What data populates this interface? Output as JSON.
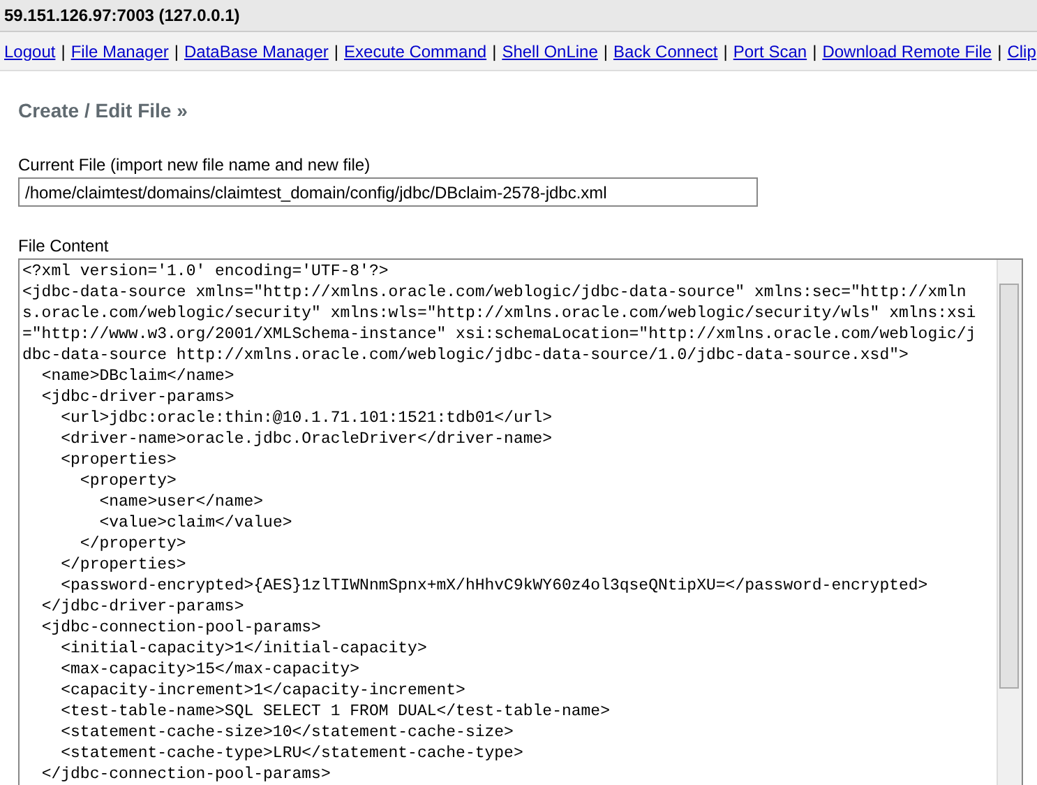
{
  "window": {
    "title": "59.151.126.97:7003 (127.0.0.1)"
  },
  "nav": {
    "separator": "|",
    "links": [
      "Logout",
      "File Manager",
      "DataBase Manager",
      "Execute Command",
      "Shell OnLine",
      "Back Connect",
      "Port Scan",
      "Download Remote File",
      "Clip"
    ]
  },
  "heading": "Create / Edit File »",
  "current_file": {
    "label": "Current File (import new file name and new file)",
    "value": "/home/claimtest/domains/claimtest_domain/config/jdbc/DBclaim-2578-jdbc.xml"
  },
  "file_content": {
    "label": "File Content",
    "lines": [
      "<?xml version='1.0' encoding='UTF-8'?>",
      "<jdbc-data-source xmlns=\"http://xmlns.oracle.com/weblogic/jdbc-data-source\" xmlns:sec=\"http://xmlns.oracle.com/weblogic/security\" xmlns:wls=\"http://xmlns.oracle.com/weblogic/security/wls\" xmlns:xsi=\"http://www.w3.org/2001/XMLSchema-instance\" xsi:schemaLocation=\"http://xmlns.oracle.com/weblogic/jdbc-data-source http://xmlns.oracle.com/weblogic/jdbc-data-source/1.0/jdbc-data-source.xsd\">",
      "  <name>DBclaim</name>",
      "  <jdbc-driver-params>",
      "    <url>jdbc:oracle:thin:@10.1.71.101:1521:tdb01</url>",
      "    <driver-name>oracle.jdbc.OracleDriver</driver-name>",
      "    <properties>",
      "      <property>",
      "        <name>user</name>",
      "        <value>claim</value>",
      "      </property>",
      "    </properties>",
      "    <password-encrypted>{AES}1zlTIWNnmSpnx+mX/hHhvC9kWY60z4ol3qseQNtipXU=</password-encrypted>",
      "  </jdbc-driver-params>",
      "  <jdbc-connection-pool-params>",
      "    <initial-capacity>1</initial-capacity>",
      "    <max-capacity>15</max-capacity>",
      "    <capacity-increment>1</capacity-increment>",
      "    <test-table-name>SQL SELECT 1 FROM DUAL</test-table-name>",
      "    <statement-cache-size>10</statement-cache-size>",
      "    <statement-cache-type>LRU</statement-cache-type>",
      "  </jdbc-connection-pool-params>"
    ]
  }
}
